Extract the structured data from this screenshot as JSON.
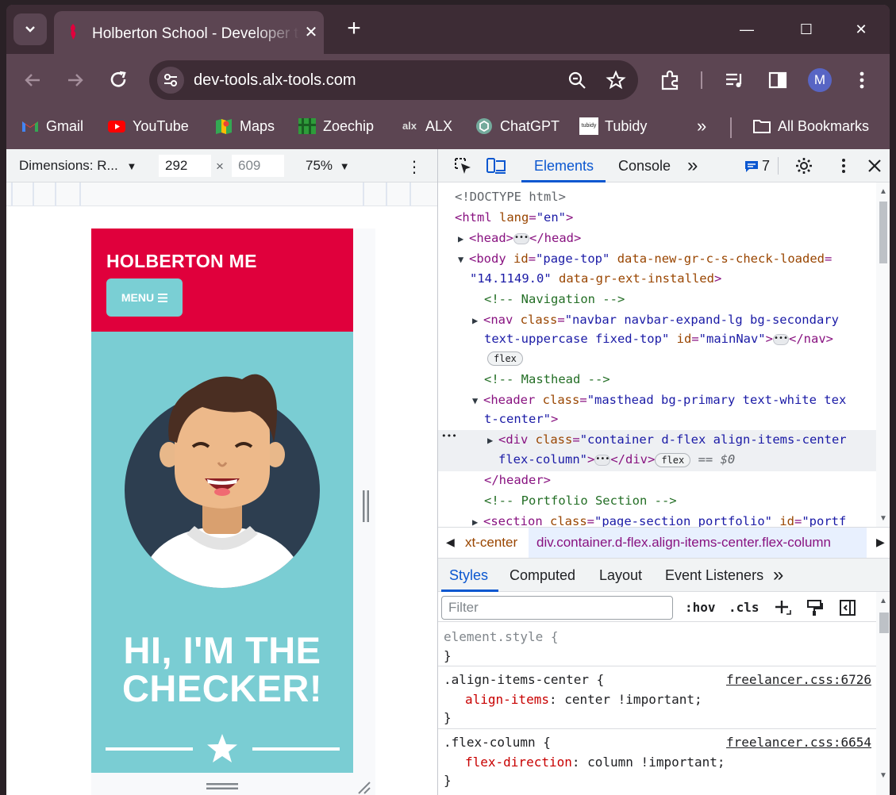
{
  "browser": {
    "tab": {
      "title": "Holberton School - Developer to",
      "close_glyph": "✕"
    },
    "new_tab_glyph": "+",
    "window_controls": {
      "minimize": "—",
      "maximize": "☐",
      "close": "✕"
    },
    "omnibox": {
      "url": "dev-tools.alx-tools.com"
    },
    "profile_initial": "M",
    "bookmarks": [
      {
        "label": "Gmail",
        "icon": "gmail-icon"
      },
      {
        "label": "YouTube",
        "icon": "youtube-icon"
      },
      {
        "label": "Maps",
        "icon": "maps-icon"
      },
      {
        "label": "Zoechip",
        "icon": "zoechip-icon"
      },
      {
        "label": "ALX",
        "icon": "alx-icon"
      },
      {
        "label": "ChatGPT",
        "icon": "chatgpt-icon"
      },
      {
        "label": "Tubidy",
        "icon": "tubidy-icon"
      }
    ],
    "bookmarks_overflow": "»",
    "all_bookmarks": "All Bookmarks",
    "alx_icon_text": "alx",
    "tubidy_icon_text": "tubidy"
  },
  "device_toolbar": {
    "dimensions_label": "Dimensions: R...",
    "width": "292",
    "times": "×",
    "height": "609",
    "zoom": "75%",
    "more": "⋮"
  },
  "site": {
    "brand": "HOLBERTON ME",
    "menu_label": "MENU",
    "hero_line1": "HI, I'M THE",
    "hero_line2": "CHECKER!",
    "colors": {
      "nav": "#e0003c",
      "masthead": "#7acdd3",
      "menu": "#7acfd4"
    }
  },
  "devtools": {
    "tabs": {
      "elements": "Elements",
      "console": "Console",
      "more": "»"
    },
    "issues_count": "7",
    "dom": {
      "doctype": "<!DOCTYPE html>",
      "html_open_tag": "<html",
      "html_lang_attr": "lang",
      "html_lang_val": "\"en\"",
      "html_close": ">",
      "head_open": "<head>",
      "head_close": "</head>",
      "body_tag": "<body",
      "body_id_attr": "id",
      "body_id_val": "\"page-top\"",
      "body_gr_attr": "data-new-gr-c-s-check-loaded",
      "body_gr_val": "\"14.1149.0\"",
      "body_ext_attr": "data-gr-ext-installed",
      "body_close": ">",
      "comment_nav": "<!-- Navigation -->",
      "nav_tag": "<nav",
      "nav_class_attr": "class",
      "nav_class_val1": "\"navbar navbar-expand-lg bg-secondary",
      "nav_class_val2": "text-uppercase fixed-top\"",
      "nav_id_attr": "id",
      "nav_id_val": "\"mainNav\"",
      "nav_gt": ">",
      "nav_close": "</nav>",
      "flex_badge": "flex",
      "comment_masthead": "<!-- Masthead -->",
      "header_tag": "<header",
      "header_class_attr": "class",
      "header_class_val1": "\"masthead bg-primary text-white tex",
      "header_class_val2": "t-center\"",
      "header_gt": ">",
      "div_tag": "<div",
      "div_class_attr": "class",
      "div_class_val1": "\"container d-flex align-items-center",
      "div_class_val2": "flex-column\"",
      "div_gt": ">",
      "div_close": "</div>",
      "eq_dollar0": "== $0",
      "row_more": "•••",
      "header_close": "</header>",
      "comment_portfolio": "<!-- Portfolio Section -->",
      "section_tag": "<section",
      "section_class_attr": "class",
      "section_class_val": "\"page-section portfolio\"",
      "section_id_attr": "id",
      "section_id_val": "\"portf"
    },
    "breadcrumbs": {
      "prev": "xt-center",
      "current": "div.container.d-flex.align-items-center.flex-column"
    },
    "styles_tabs": [
      "Styles",
      "Computed",
      "Layout",
      "Event Listeners"
    ],
    "styles_more": "»",
    "filter_placeholder": "Filter",
    "hov": ":hov",
    "cls": ".cls",
    "rules": [
      {
        "selector": "element.style {",
        "close": "}"
      },
      {
        "selector": ".align-items-center {",
        "source": "freelancer.css:6726",
        "prop": "align-items",
        "value": ": center !important;",
        "close": "}"
      },
      {
        "selector": ".flex-column {",
        "source": "freelancer.css:6654",
        "prop": "flex-direction",
        "value": ": column !important;",
        "close": "}"
      }
    ]
  }
}
